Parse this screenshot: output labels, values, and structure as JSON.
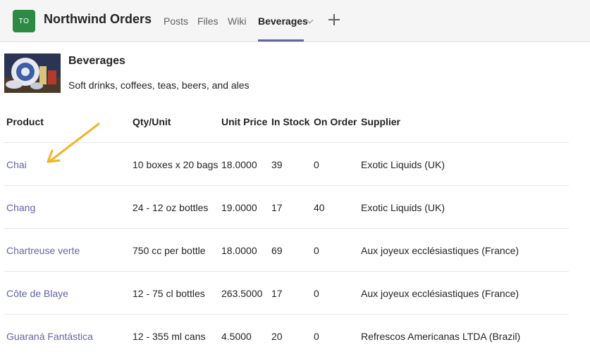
{
  "header": {
    "team_initials": "TO",
    "team_name": "Northwind Orders",
    "tabs": [
      {
        "label": "Posts"
      },
      {
        "label": "Files"
      },
      {
        "label": "Wiki"
      },
      {
        "label": "Beverages"
      }
    ],
    "accent_color": "#6264a7",
    "avatar_color": "#2c8a44"
  },
  "category": {
    "title": "Beverages",
    "description": "Soft drinks, coffees, teas, beers, and ales"
  },
  "table": {
    "columns": [
      "Product",
      "Qty/Unit",
      "Unit Price",
      "In Stock",
      "On Order",
      "Supplier"
    ],
    "rows": [
      {
        "product": "Chai",
        "qty": "10 boxes x 20 bags",
        "price": "18.0000",
        "stock": "39",
        "order": "0",
        "supplier": "Exotic Liquids (UK)"
      },
      {
        "product": "Chang",
        "qty": "24 - 12 oz bottles",
        "price": "19.0000",
        "stock": "17",
        "order": "40",
        "supplier": "Exotic Liquids (UK)"
      },
      {
        "product": "Chartreuse verte",
        "qty": "750 cc per bottle",
        "price": "18.0000",
        "stock": "69",
        "order": "0",
        "supplier": "Aux joyeux ecclésiastiques (France)"
      },
      {
        "product": "Côte de Blaye",
        "qty": "12 - 75 cl bottles",
        "price": "263.5000",
        "stock": "17",
        "order": "0",
        "supplier": "Aux joyeux ecclésiastiques (France)"
      },
      {
        "product": "Guaraná Fantástica",
        "qty": "12 - 355 ml cans",
        "price": "4.5000",
        "stock": "20",
        "order": "0",
        "supplier": "Refrescos Americanas LTDA (Brazil)"
      }
    ]
  },
  "annotation_color": "#f0b429"
}
